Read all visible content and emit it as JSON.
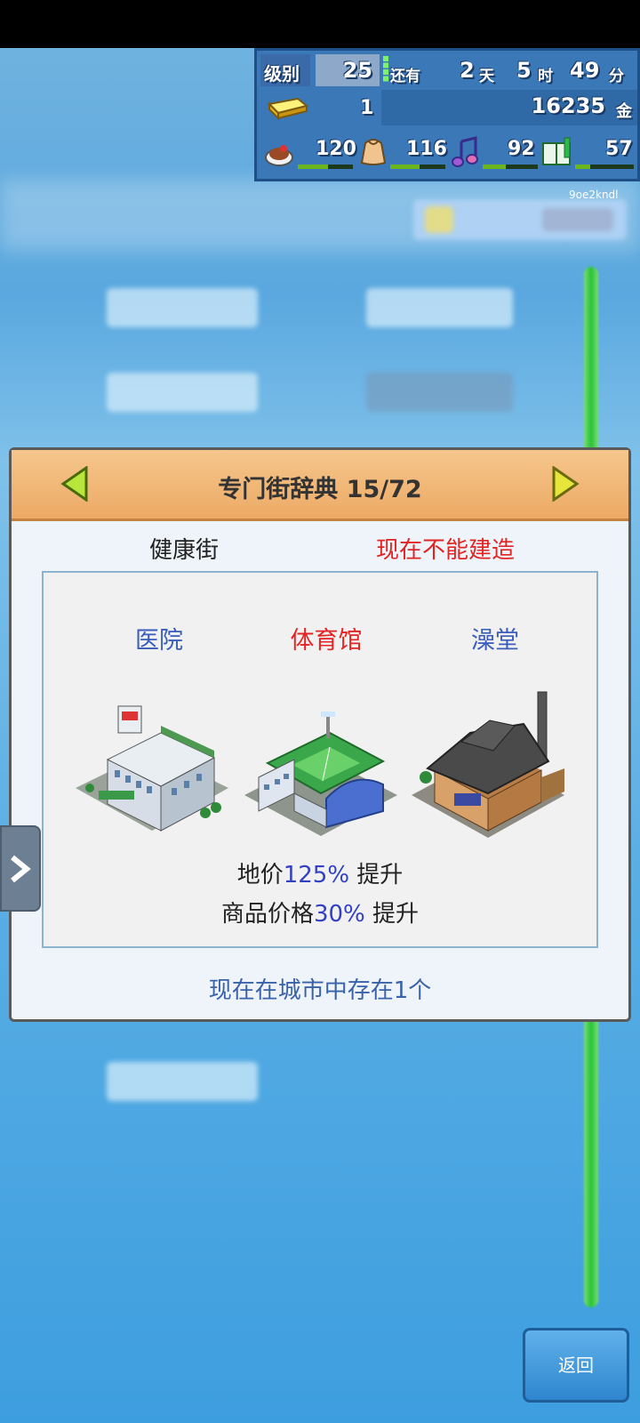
{
  "hud": {
    "level_label": "级别",
    "level_value": "25",
    "remaining_label": "还有",
    "days_value": "2",
    "days_unit": "天",
    "hours_value": "5",
    "hours_unit": "时",
    "minutes_value": "49",
    "minutes_unit": "分",
    "gold_bars": "1",
    "money_value": "16235",
    "money_unit": "金",
    "stats": [
      {
        "icon": "food-icon",
        "value": "120",
        "fill": 0.55
      },
      {
        "icon": "bag-icon",
        "value": "116",
        "fill": 0.53
      },
      {
        "icon": "music-icon",
        "value": "92",
        "fill": 0.42
      },
      {
        "icon": "book-icon",
        "value": "57",
        "fill": 0.26
      }
    ]
  },
  "tag_id": "9oe2kndl",
  "dialog": {
    "title": "专门街辞典 15/72",
    "district_name": "健康街",
    "status": "现在不能建造",
    "buildings": [
      {
        "name": "医院",
        "color": "#3a5dbc"
      },
      {
        "name": "体育馆",
        "color": "#e22424"
      },
      {
        "name": "澡堂",
        "color": "#3a5dbc"
      }
    ],
    "effect1_prefix": "地价",
    "effect1_value": "125%",
    "effect1_suffix": " 提升",
    "effect2_prefix": "商品价格",
    "effect2_value": "30%",
    "effect2_suffix": " 提升",
    "exist_text": "现在在城市中存在1个"
  },
  "back_button_label": "返回"
}
